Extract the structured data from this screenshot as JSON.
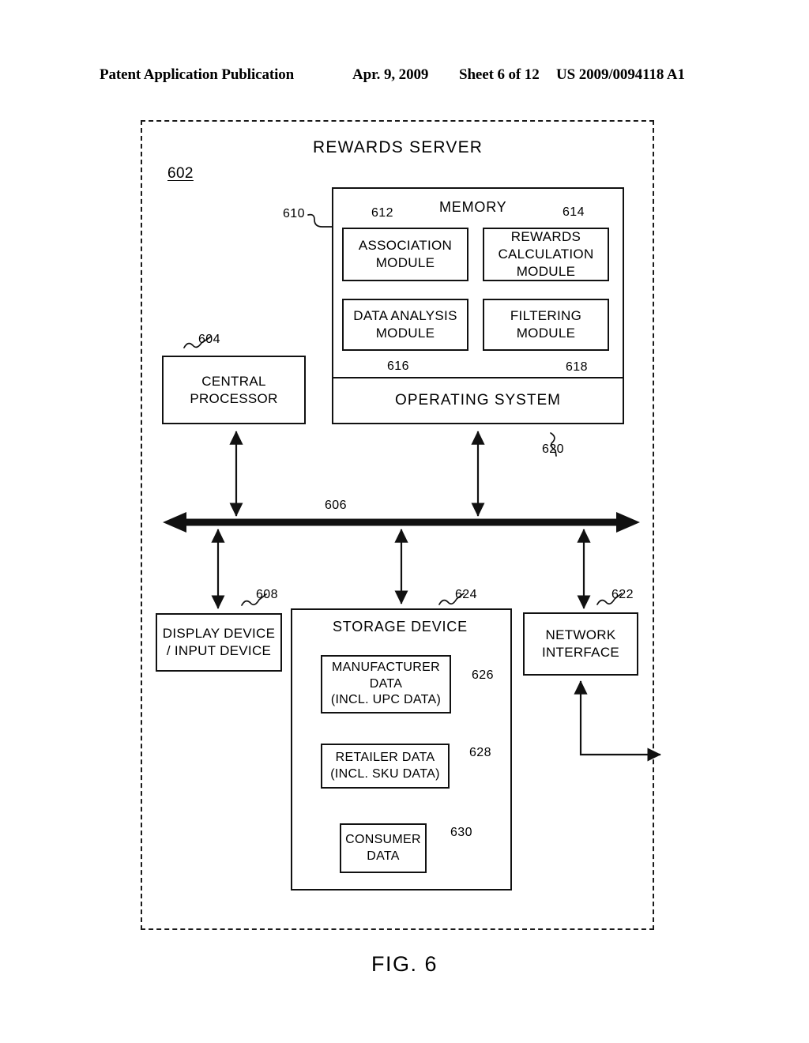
{
  "header": {
    "publication": "Patent Application Publication",
    "date": "Apr. 9, 2009",
    "sheet": "Sheet 6 of 12",
    "patent_number": "US 2009/0094118 A1"
  },
  "figure": {
    "caption": "FIG. 6"
  },
  "diagram": {
    "server_title": "REWARDS SERVER",
    "server_ref": "602",
    "memory": {
      "title": "MEMORY",
      "ref": "610",
      "modules": [
        {
          "label": "ASSOCIATION\nMODULE",
          "ref": "612"
        },
        {
          "label": "REWARDS\nCALCULATION\nMODULE",
          "ref": "614"
        },
        {
          "label": "DATA ANALYSIS\nMODULE",
          "ref": "616"
        },
        {
          "label": "FILTERING\nMODULE",
          "ref": "618"
        }
      ],
      "operating_system": {
        "label": "OPERATING SYSTEM",
        "ref": "620"
      }
    },
    "central_processor": {
      "label": "CENTRAL\nPROCESSOR",
      "ref": "604"
    },
    "bus": {
      "ref": "606"
    },
    "display_device": {
      "label": "DISPLAY DEVICE\n/ INPUT DEVICE",
      "ref": "608"
    },
    "network_interface": {
      "label": "NETWORK\nINTERFACE",
      "ref": "622"
    },
    "storage_device": {
      "title": "STORAGE DEVICE",
      "ref": "624",
      "items": [
        {
          "label": "MANUFACTURER\nDATA\n(INCL. UPC DATA)",
          "ref": "626"
        },
        {
          "label": "RETAILER DATA\n(INCL. SKU DATA)",
          "ref": "628"
        },
        {
          "label": "CONSUMER\nDATA",
          "ref": "630"
        }
      ]
    }
  }
}
